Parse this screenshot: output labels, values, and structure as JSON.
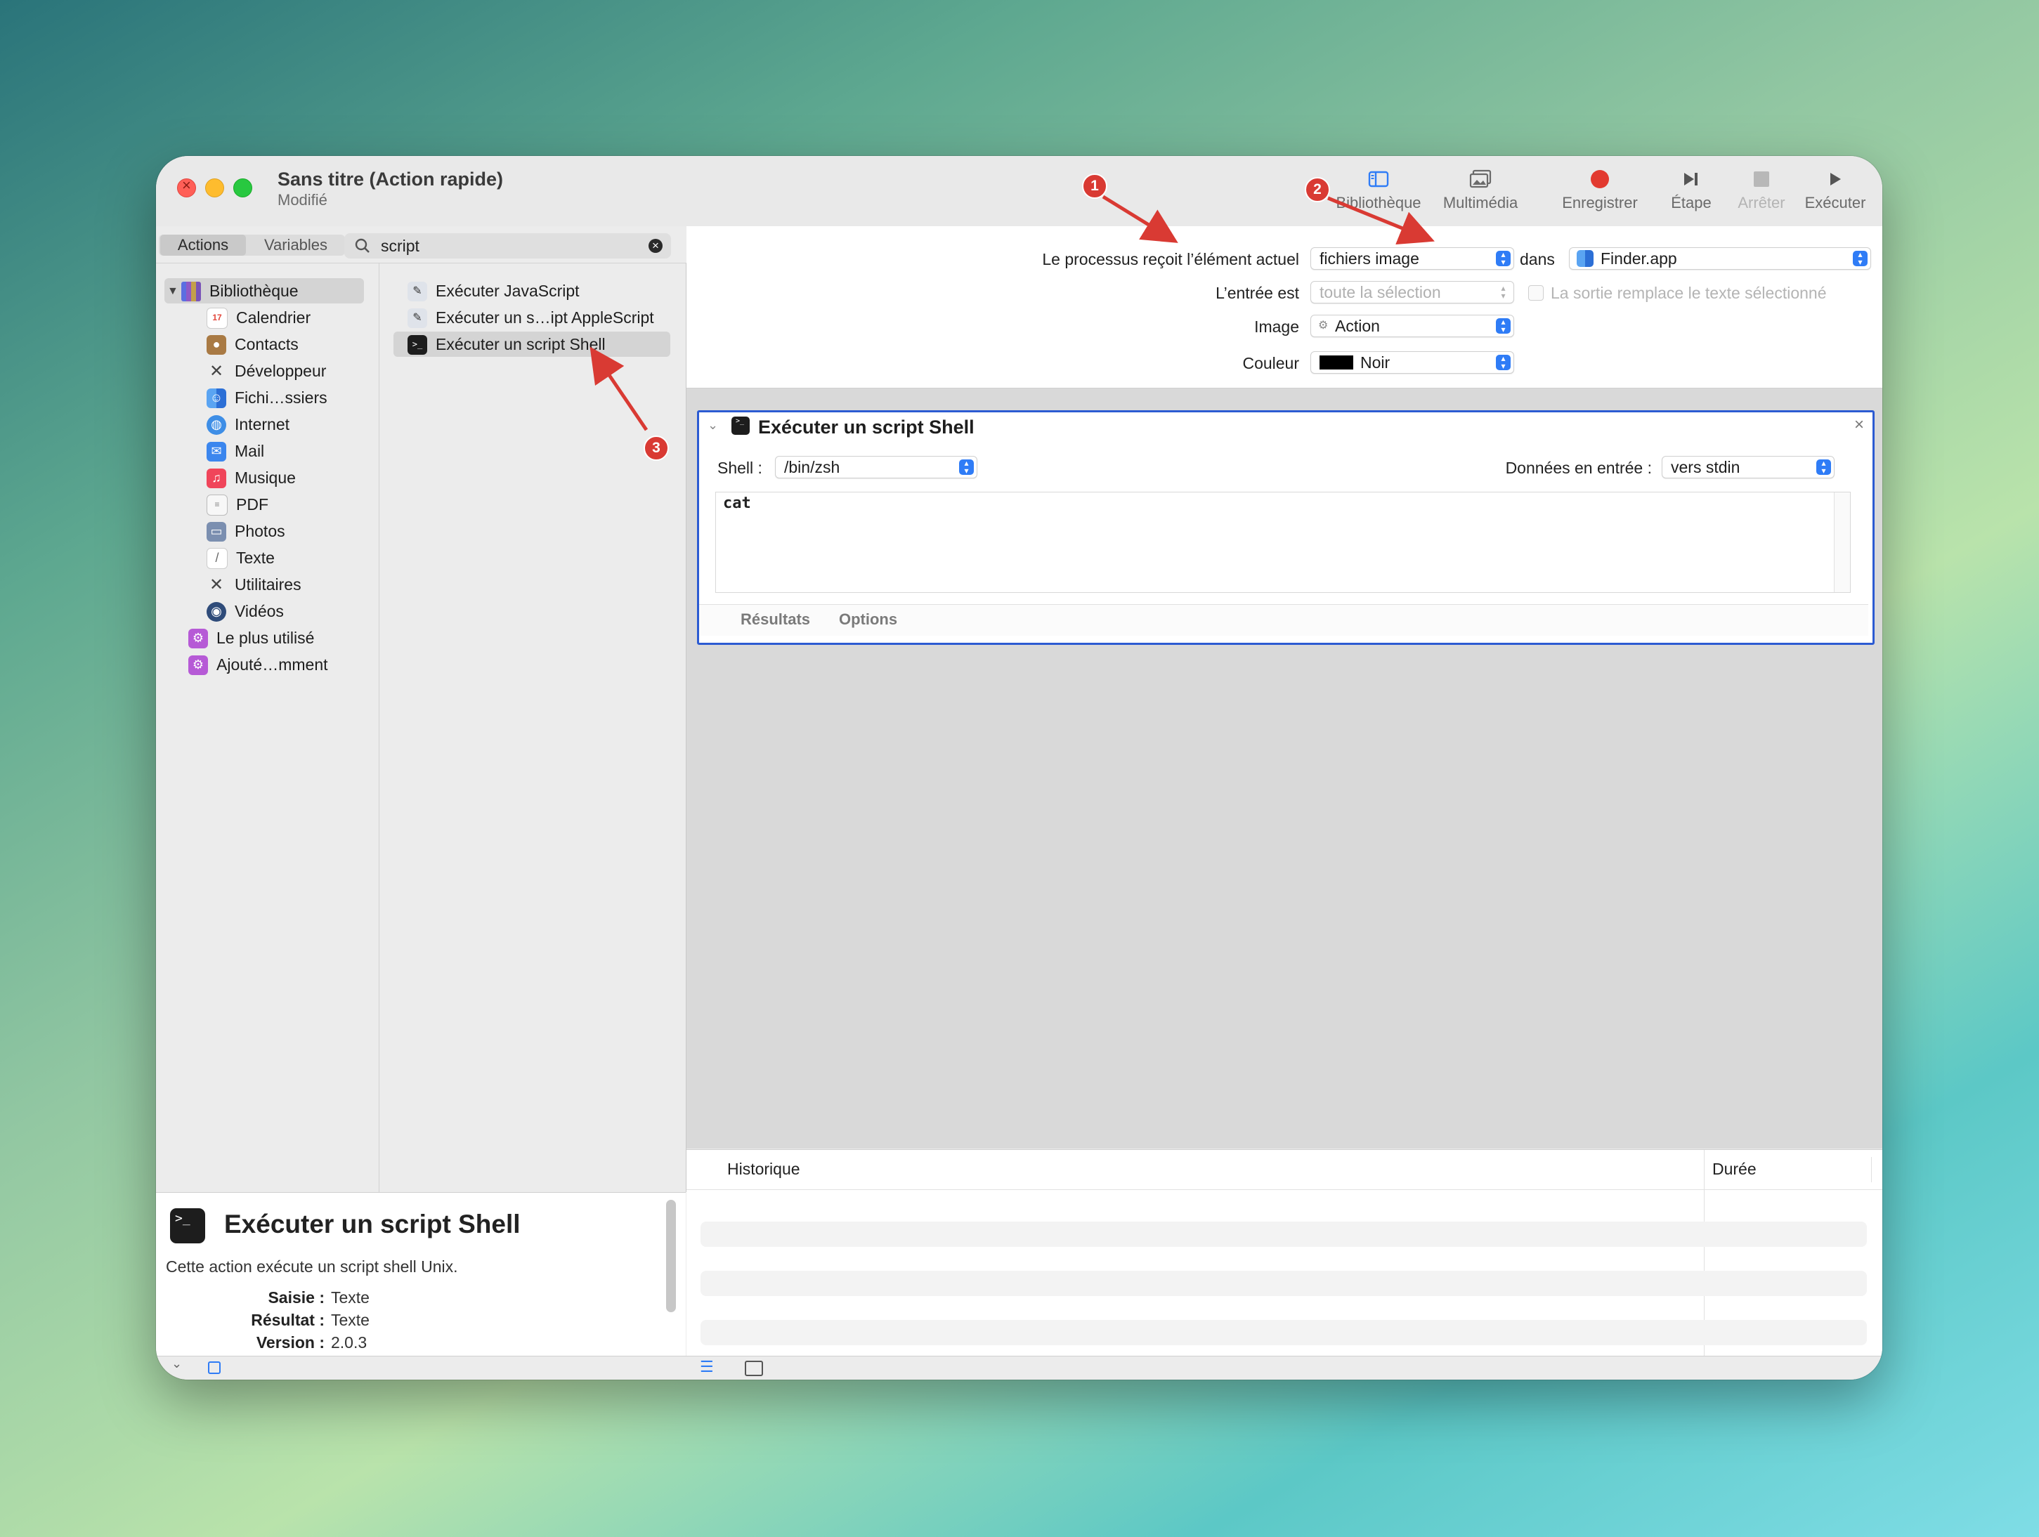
{
  "window": {
    "title": "Sans titre (Action rapide)",
    "subtitle": "Modifié"
  },
  "toolbar": {
    "library": "Bibliothèque",
    "media": "Multimédia",
    "record": "Enregistrer",
    "step": "Étape",
    "stop": "Arrêter",
    "run": "Exécuter"
  },
  "sidebar_tabs": {
    "actions": "Actions",
    "variables": "Variables"
  },
  "search": {
    "value": "script"
  },
  "library": {
    "root": "Bibliothèque",
    "items": [
      "Calendrier",
      "Contacts",
      "Développeur",
      "Fichi…ssiers",
      "Internet",
      "Mail",
      "Musique",
      "PDF",
      "Photos",
      "Texte",
      "Utilitaires",
      "Vidéos"
    ],
    "smart": [
      "Le plus utilisé",
      "Ajouté…mment"
    ]
  },
  "actions_list": [
    "Exécuter JavaScript",
    "Exécuter un s…ipt AppleScript",
    "Exécuter un script Shell"
  ],
  "description": {
    "title": "Exécuter un script Shell",
    "text": "Cette action exécute un script shell Unix.",
    "input_label": "Saisie :",
    "input_value": "Texte",
    "result_label": "Résultat :",
    "result_value": "Texte",
    "version_label": "Version :",
    "version_value": "2.0.3"
  },
  "workflow_header": {
    "receives_label": "Le processus reçoit l’élément actuel",
    "receives_value": "fichiers image",
    "in_label": "dans",
    "app_value": "Finder.app",
    "input_is_label": "L’entrée est",
    "input_is_value": "toute la sélection",
    "replace_label": "La sortie remplace le texte sélectionné",
    "image_label": "Image",
    "image_value": "Action",
    "color_label": "Couleur",
    "color_value": "Noir"
  },
  "action_box": {
    "title": "Exécuter un script Shell",
    "shell_label": "Shell :",
    "shell_value": "/bin/zsh",
    "input_label": "Données en entrée :",
    "input_value": "vers stdin",
    "script": "cat",
    "tab_results": "Résultats",
    "tab_options": "Options"
  },
  "history": {
    "col_history": "Historique",
    "col_duration": "Durée"
  },
  "annotations": [
    "1",
    "2",
    "3"
  ],
  "colors": {
    "accent": "#2f7cf6",
    "selection_border": "#2c5bd2",
    "annotation": "#d93a33",
    "record": "#e23a30"
  }
}
